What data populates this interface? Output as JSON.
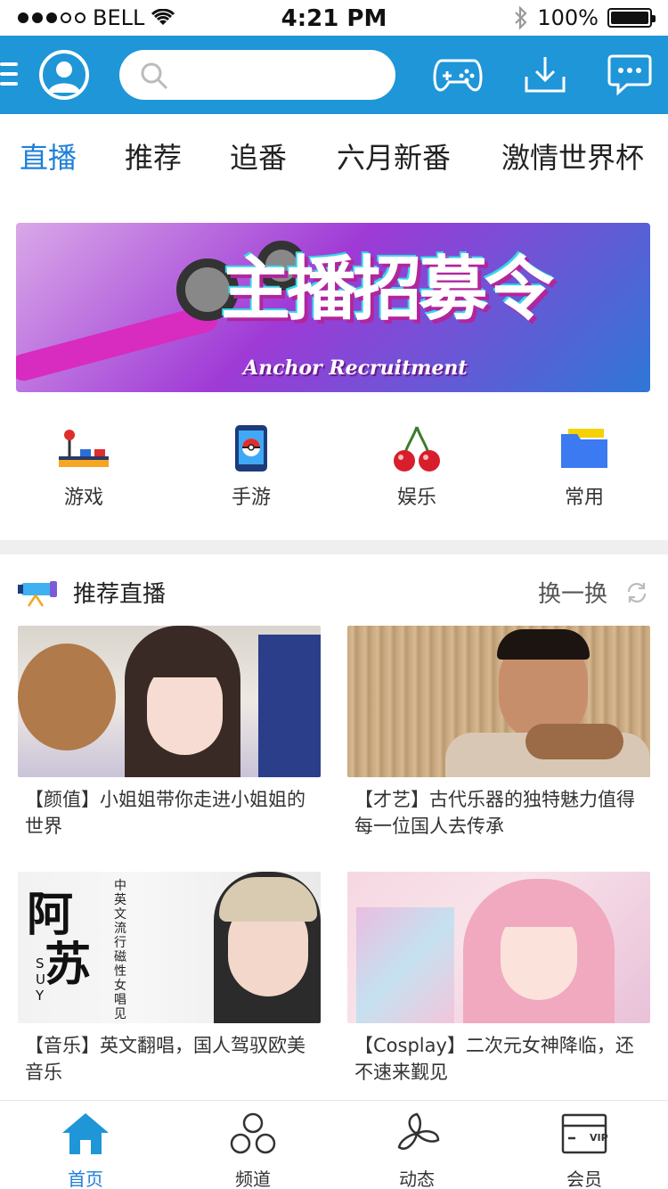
{
  "status_bar": {
    "carrier": "BELL",
    "time": "4:21 PM",
    "battery": "100%"
  },
  "header": {
    "search_placeholder": "",
    "icons": [
      "menu-icon",
      "profile-icon",
      "search-icon",
      "gamepad-icon",
      "download-icon",
      "message-icon"
    ],
    "accent_color": "#1E96D8"
  },
  "tabs": [
    {
      "label": "直播",
      "active": true
    },
    {
      "label": "推荐",
      "active": false
    },
    {
      "label": "追番",
      "active": false
    },
    {
      "label": "六月新番",
      "active": false
    },
    {
      "label": "激情世界杯",
      "active": false
    }
  ],
  "banner": {
    "title": "主播招募令",
    "subtitle": "Anchor Recruitment"
  },
  "categories": [
    {
      "label": "游戏",
      "icon": "joystick-icon"
    },
    {
      "label": "手游",
      "icon": "phone-game-icon"
    },
    {
      "label": "娱乐",
      "icon": "cherry-icon"
    },
    {
      "label": "常用",
      "icon": "folder-icon"
    }
  ],
  "recommend": {
    "title": "推荐直播",
    "swap_label": "换一换",
    "items": [
      {
        "caption": "【颜值】小姐姐带你走进小姐姐的世界"
      },
      {
        "caption": "【才艺】古代乐器的独特魅力值得每一位国人去传承"
      },
      {
        "caption": "【音乐】英文翻唱，国人驾驭欧美音乐"
      },
      {
        "caption": "【Cosplay】二次元女神降临，还不速来觐见"
      }
    ]
  },
  "thumb_text": {
    "name_1": "阿",
    "name_2": "苏",
    "suy": "S U Y",
    "vertical": "中英文流行磁性女唱见"
  },
  "bottom_nav": [
    {
      "label": "首页",
      "active": true
    },
    {
      "label": "频道",
      "active": false
    },
    {
      "label": "动态",
      "active": false
    },
    {
      "label": "会员",
      "active": false
    }
  ],
  "vip_text": "VIP"
}
